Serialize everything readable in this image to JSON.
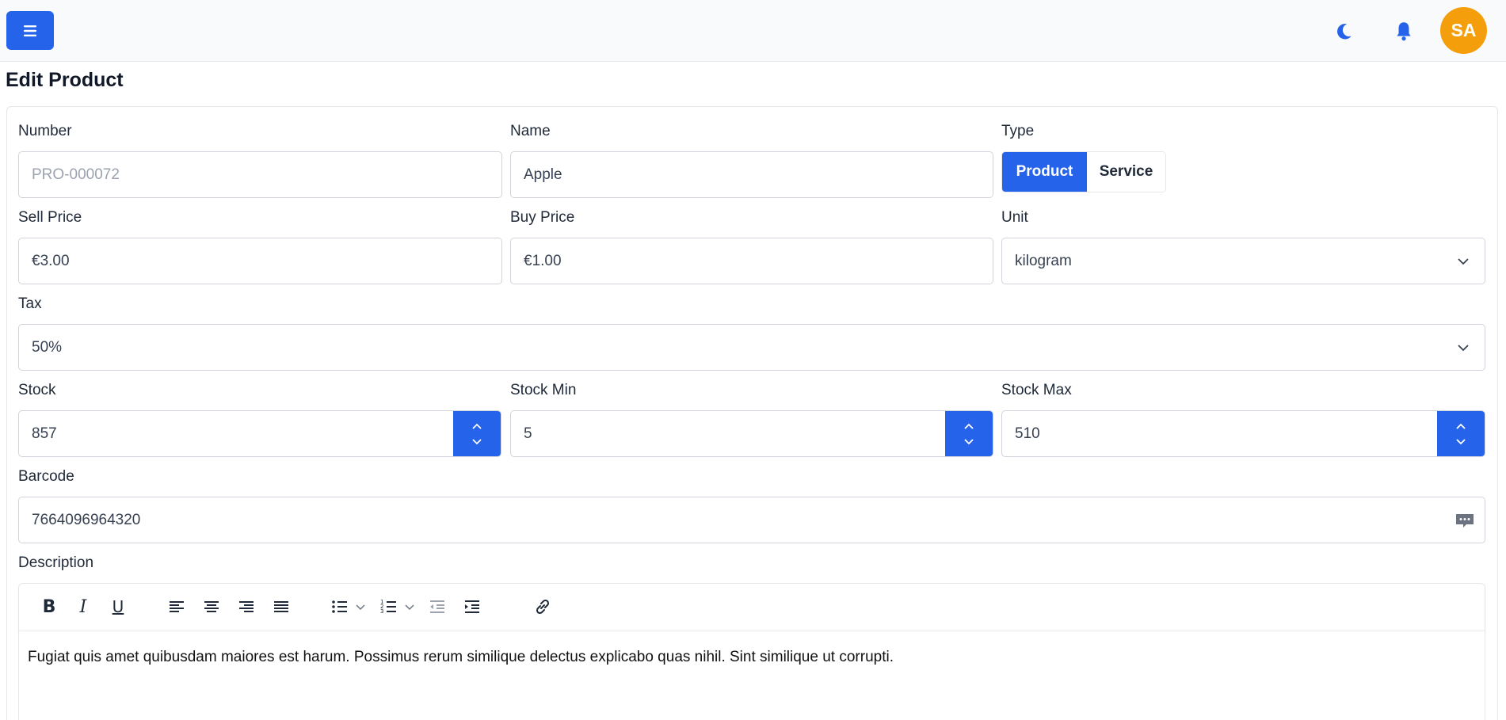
{
  "header": {
    "avatar_initials": "SA",
    "icons": [
      "menu-icon",
      "moon-icon",
      "bell-icon"
    ],
    "accent_color": "#2563eb",
    "avatar_color": "#f59e0b"
  },
  "page": {
    "title": "Edit Product"
  },
  "form": {
    "number": {
      "label": "Number",
      "placeholder": "PRO-000072"
    },
    "name": {
      "label": "Name",
      "value": "Apple"
    },
    "type": {
      "label": "Type",
      "options": [
        "Product",
        "Service"
      ],
      "selected": "Product"
    },
    "sell_price": {
      "label": "Sell Price",
      "value": "€3.00"
    },
    "buy_price": {
      "label": "Buy Price",
      "value": "€1.00"
    },
    "unit": {
      "label": "Unit",
      "value": "kilogram"
    },
    "tax": {
      "label": "Tax",
      "value": "50%"
    },
    "stock": {
      "label": "Stock",
      "value": "857"
    },
    "stock_min": {
      "label": "Stock Min",
      "value": "5"
    },
    "stock_max": {
      "label": "Stock Max",
      "value": "510"
    },
    "barcode": {
      "label": "Barcode",
      "value": "7664096964320"
    },
    "description": {
      "label": "Description",
      "toolbar": [
        "bold",
        "italic",
        "underline",
        "align-left",
        "align-center",
        "align-right",
        "align-justify",
        "bullet-list",
        "numbered-list",
        "outdent",
        "indent",
        "link"
      ],
      "text": "Fugiat quis amet quibusdam maiores est harum. Possimus rerum similique delectus explicabo quas nihil. Sint similique ut corrupti."
    }
  }
}
